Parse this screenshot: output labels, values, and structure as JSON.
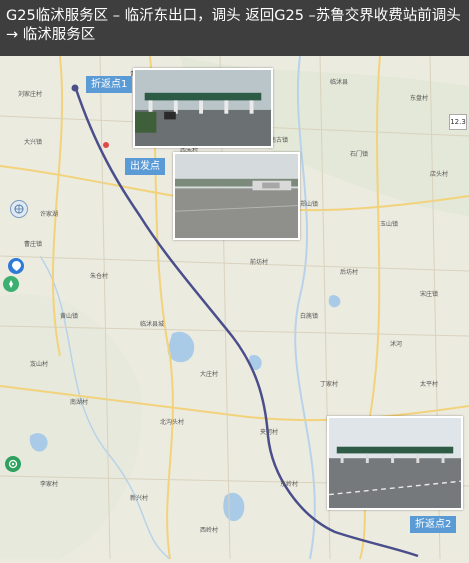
{
  "header": {
    "title": "G25临沭服务区 – 临沂东出口，调头 返回G25 –苏鲁交界收费站前调头→ 临沭服务区"
  },
  "markers": {
    "turnaround1": "折返点1",
    "start": "出发点",
    "turnaround2": "折返点2"
  },
  "map": {
    "scale_badge": "12.3",
    "route_color": "#4a4e8a",
    "tag_color": "#5b9bd5",
    "places": [
      "刘家庄村",
      "青云镇",
      "大官庄村",
      "朱村",
      "临沭县",
      "东盘村",
      "大兴镇",
      "西朱村",
      "南古镇",
      "石门镇",
      "店头村",
      "许家湖",
      "蛟龙镇",
      "郑山镇",
      "玉山镇",
      "曹庄镇",
      "朱仓村",
      "前坊村",
      "后坊村",
      "宋庄镇",
      "黄山镇",
      "临沭县城",
      "白旄镇",
      "沭河",
      "岌山村",
      "大庄村",
      "丁家村",
      "太平村",
      "南湖村",
      "北沟头村",
      "夹河村",
      "王庄村",
      "李家村",
      "新兴村",
      "西岭村",
      "东岭村"
    ]
  },
  "icons": [
    "globe-icon",
    "location-pin-icon",
    "compass-icon",
    "target-icon"
  ]
}
